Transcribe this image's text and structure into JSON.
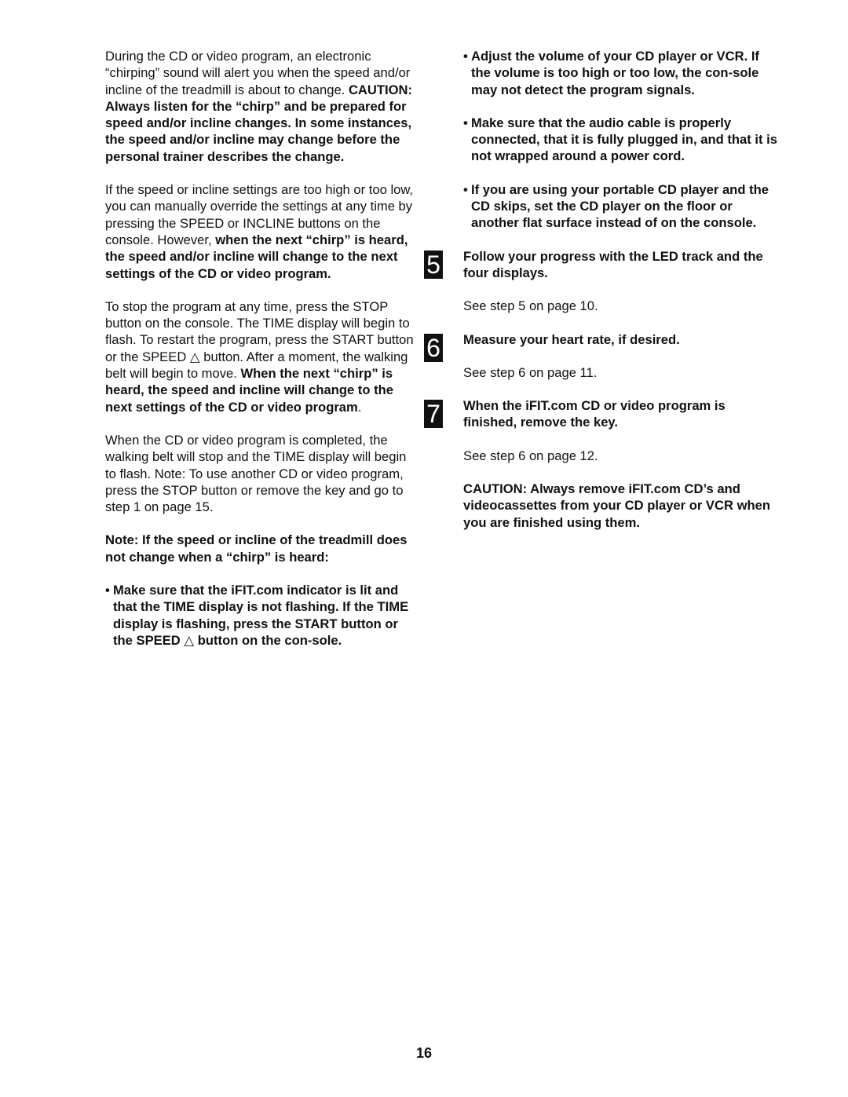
{
  "left_column": {
    "p1": {
      "normal": "During the CD or video program, an electronic “chirping” sound will alert you when the speed and/or incline of the treadmill is about to change. ",
      "bold": "CAUTION: Always listen for the “chirp” and be prepared for speed and/or incline changes. In some instances, the speed and/or incline may change before the personal trainer describes the change."
    },
    "p2": {
      "normal": "If the speed or incline settings are too high or too low, you can manually override the settings at any time by pressing the SPEED or INCLINE buttons on the console. However, ",
      "bold": "when the next “chirp” is heard, the speed and/or incline will change to the next settings of the CD or video program."
    },
    "p3": {
      "normal_a": "To stop the program at any time, press the STOP button on the console. The TIME display will begin to flash. To restart the program, press the START button or the SPEED ",
      "triangle": "△",
      "normal_b": " button. After a moment, the walking belt will begin to move. ",
      "bold": "When the next “chirp” is heard, the speed and incline will change to the next settings of the CD or video program",
      "end": "."
    },
    "p4": "When the CD or video program is completed, the walking belt will stop and the TIME display will begin to flash. Note: To use another CD or video program, press the STOP button or remove the key and go to step 1 on page 15.",
    "note": "Note: If the speed or incline of the treadmill does not change when a “chirp” is heard:",
    "bullet1": {
      "dot": "•",
      "text_a": "Make sure that the iFIT.com indicator is lit and that the TIME display is not flashing. If the TIME display is flashing, press the START button or the SPEED ",
      "triangle": "△",
      "text_b": " button on the con-sole."
    }
  },
  "right_column": {
    "bullets": [
      {
        "dot": "•",
        "text": "Adjust the volume of your CD player or VCR. If the volume is too high or too low, the con-sole may not detect the program signals."
      },
      {
        "dot": "•",
        "text": "Make sure that the audio cable is properly connected, that it is fully plugged in, and that it is not wrapped around a power cord."
      },
      {
        "dot": "•",
        "text": "If you are using your portable CD player and the CD skips, set the CD player on the floor or another flat surface instead of on the console."
      }
    ],
    "steps": [
      {
        "number": "5",
        "title": "Follow your progress with the LED track and the four displays.",
        "see": "See step 5 on page 10."
      },
      {
        "number": "6",
        "title": "Measure your heart rate, if desired.",
        "see": "See step 6 on page 11."
      },
      {
        "number": "7",
        "title": "When the iFIT.com CD or video program is finished, remove the key.",
        "see": "See step 6 on page 12."
      }
    ],
    "caution": "CAUTION: Always remove iFIT.com CD’s and videocassettes from your CD player or VCR when you are finished using them."
  },
  "page_number": "16"
}
